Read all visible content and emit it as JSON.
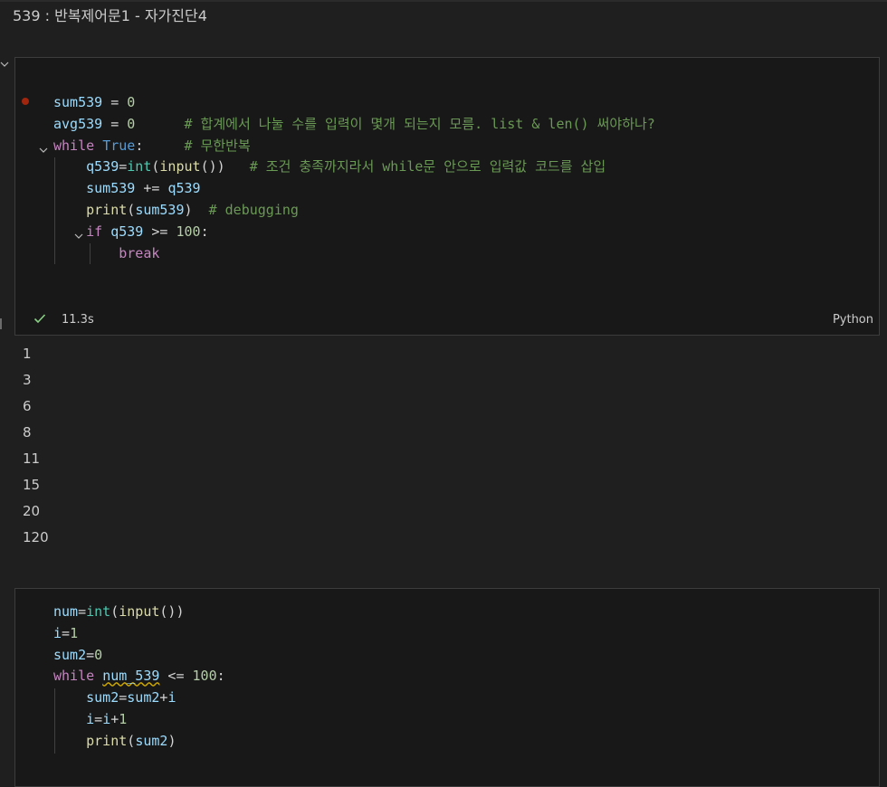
{
  "title": "539 : 반복제어문1 - 자가진단4",
  "cell1": {
    "lines": [
      {
        "id": "l1",
        "parts": [
          [
            "v",
            "sum539"
          ],
          [
            "o",
            " = "
          ],
          [
            "n",
            "0"
          ]
        ]
      },
      {
        "id": "l2",
        "parts": [
          [
            "v",
            "avg539"
          ],
          [
            "o",
            " = "
          ],
          [
            "n",
            "0"
          ],
          [
            "o",
            "      "
          ],
          [
            "c",
            "# 합계에서 나눌 수를 입력이 몇개 되는지 모름. list & len() 써야하나?"
          ]
        ]
      },
      {
        "id": "l3",
        "parts": [
          [
            "k",
            "while"
          ],
          [
            "o",
            " "
          ],
          [
            "t",
            "True"
          ],
          [
            "o",
            ":     "
          ],
          [
            "c",
            "# 무한반복"
          ]
        ]
      },
      {
        "id": "l4",
        "parts": [
          [
            "o",
            "    "
          ],
          [
            "v",
            "q539"
          ],
          [
            "o",
            "="
          ],
          [
            "b",
            "int"
          ],
          [
            "o",
            "("
          ],
          [
            "f",
            "input"
          ],
          [
            "o",
            "())   "
          ],
          [
            "c",
            "# 조건 충족까지라서 while문 안으로 입력값 코드를 삽입"
          ]
        ]
      },
      {
        "id": "l5",
        "parts": [
          [
            "o",
            "    "
          ],
          [
            "v",
            "sum539"
          ],
          [
            "o",
            " += "
          ],
          [
            "v",
            "q539"
          ]
        ]
      },
      {
        "id": "l6",
        "parts": [
          [
            "o",
            "    "
          ],
          [
            "f",
            "print"
          ],
          [
            "o",
            "("
          ],
          [
            "v",
            "sum539"
          ],
          [
            "o",
            ")  "
          ],
          [
            "c",
            "# debugging"
          ]
        ]
      },
      {
        "id": "l7",
        "parts": [
          [
            "o",
            "    "
          ],
          [
            "k",
            "if"
          ],
          [
            "o",
            " "
          ],
          [
            "v",
            "q539"
          ],
          [
            "o",
            " >= "
          ],
          [
            "n",
            "100"
          ],
          [
            "o",
            ":"
          ]
        ]
      },
      {
        "id": "l8",
        "parts": [
          [
            "o",
            "        "
          ],
          [
            "k",
            "break"
          ]
        ]
      }
    ],
    "exec_time": "11.3s",
    "language": "Python"
  },
  "output": [
    "1",
    "3",
    "6",
    "8",
    "11",
    "15",
    "20",
    "120"
  ],
  "cell2": {
    "lines": [
      {
        "id": "m1",
        "parts": [
          [
            "v",
            "num"
          ],
          [
            "o",
            "="
          ],
          [
            "b",
            "int"
          ],
          [
            "o",
            "("
          ],
          [
            "f",
            "input"
          ],
          [
            "o",
            "())"
          ]
        ]
      },
      {
        "id": "m2",
        "parts": [
          [
            "v",
            "i"
          ],
          [
            "o",
            "="
          ],
          [
            "n",
            "1"
          ]
        ]
      },
      {
        "id": "m3",
        "parts": [
          [
            "v",
            "sum2"
          ],
          [
            "o",
            "="
          ],
          [
            "n",
            "0"
          ]
        ]
      },
      {
        "id": "m4",
        "parts": [
          [
            "k",
            "while"
          ],
          [
            "o",
            " "
          ],
          [
            "v squig",
            "num_539"
          ],
          [
            "o",
            " <= "
          ],
          [
            "n",
            "100"
          ],
          [
            "o",
            ":"
          ]
        ]
      },
      {
        "id": "m5",
        "parts": [
          [
            "o",
            "    "
          ],
          [
            "v",
            "sum2"
          ],
          [
            "o",
            "="
          ],
          [
            "v",
            "sum2"
          ],
          [
            "o",
            "+"
          ],
          [
            "v",
            "i"
          ]
        ]
      },
      {
        "id": "m6",
        "parts": [
          [
            "o",
            "    "
          ],
          [
            "v",
            "i"
          ],
          [
            "o",
            "="
          ],
          [
            "v",
            "i"
          ],
          [
            "o",
            "+"
          ],
          [
            "n",
            "1"
          ]
        ]
      },
      {
        "id": "m7",
        "parts": [
          [
            "o",
            "    "
          ],
          [
            "f",
            "print"
          ],
          [
            "o",
            "("
          ],
          [
            "v",
            "sum2"
          ],
          [
            "o",
            ")"
          ]
        ]
      }
    ]
  },
  "icons": {
    "collapse": "chevron-down-icon",
    "fold": "fold-chevron-icon",
    "status": "check-icon",
    "breakpoint": "breakpoint-icon"
  },
  "colors": {
    "background": "#1f1f1f",
    "cell_background": "#181818",
    "keyword": "#c586c0",
    "variable": "#9cdcfe",
    "comment": "#6a9955",
    "number": "#b5cea8",
    "constant": "#569cd6",
    "function": "#dcdcaa",
    "builtin_type": "#4ec9b0",
    "breakpoint": "#a1260d",
    "success": "#89d185"
  }
}
